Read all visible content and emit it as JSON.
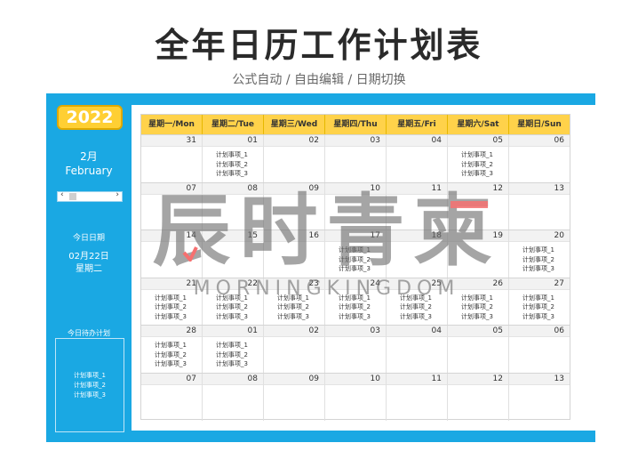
{
  "title": "全年日历工作计划表",
  "subtitle": "公式自动 / 自由编辑 / 日期切换",
  "sidebar": {
    "year": "2022",
    "month_cn": "2月",
    "month_en": "February",
    "scroll_left": "‹",
    "scroll_right": "›",
    "today_label": "今日日期",
    "today_date": "02月22日",
    "today_weekday": "星期二",
    "todo_title": "今日待办计划",
    "todo_items": [
      "计划事项_1",
      "计划事项_2",
      "计划事项_3"
    ]
  },
  "calendar": {
    "weekdays": [
      "星期一/Mon",
      "星期二/Tue",
      "星期三/Wed",
      "星期四/Thu",
      "星期五/Fri",
      "星期六/Sat",
      "星期日/Sun"
    ],
    "weeks": [
      {
        "days": [
          {
            "date": "31",
            "plans": []
          },
          {
            "date": "01",
            "plans": [
              "计划事项_1",
              "计划事项_2",
              "计划事项_3"
            ]
          },
          {
            "date": "02",
            "plans": []
          },
          {
            "date": "03",
            "plans": []
          },
          {
            "date": "04",
            "plans": []
          },
          {
            "date": "05",
            "plans": [
              "计划事项_1",
              "计划事项_2",
              "计划事项_3"
            ]
          },
          {
            "date": "06",
            "plans": []
          }
        ]
      },
      {
        "days": [
          {
            "date": "07",
            "plans": []
          },
          {
            "date": "08",
            "plans": []
          },
          {
            "date": "09",
            "plans": []
          },
          {
            "date": "10",
            "plans": []
          },
          {
            "date": "11",
            "plans": []
          },
          {
            "date": "12",
            "plans": []
          },
          {
            "date": "13",
            "plans": []
          }
        ]
      },
      {
        "days": [
          {
            "date": "14",
            "plans": []
          },
          {
            "date": "15",
            "plans": []
          },
          {
            "date": "16",
            "plans": []
          },
          {
            "date": "17",
            "plans": [
              "计划事项_1",
              "计划事项_2",
              "计划事项_3"
            ]
          },
          {
            "date": "18",
            "plans": []
          },
          {
            "date": "19",
            "plans": []
          },
          {
            "date": "20",
            "plans": [
              "计划事项_1",
              "计划事项_2",
              "计划事项_3"
            ]
          }
        ]
      },
      {
        "days": [
          {
            "date": "21",
            "plans": [
              "计划事项_1",
              "计划事项_2",
              "计划事项_3"
            ]
          },
          {
            "date": "22",
            "plans": [
              "计划事项_1",
              "计划事项_2",
              "计划事项_3"
            ]
          },
          {
            "date": "23",
            "plans": [
              "计划事项_1",
              "计划事项_2",
              "计划事项_3"
            ]
          },
          {
            "date": "24",
            "plans": [
              "计划事项_1",
              "计划事项_2",
              "计划事项_3"
            ]
          },
          {
            "date": "25",
            "plans": [
              "计划事项_1",
              "计划事项_2",
              "计划事项_3"
            ]
          },
          {
            "date": "26",
            "plans": [
              "计划事项_1",
              "计划事项_2",
              "计划事项_3"
            ]
          },
          {
            "date": "27",
            "plans": [
              "计划事项_1",
              "计划事项_2",
              "计划事项_3"
            ]
          }
        ]
      },
      {
        "days": [
          {
            "date": "28",
            "plans": [
              "计划事项_1",
              "计划事项_2",
              "计划事项_3"
            ]
          },
          {
            "date": "01",
            "plans": [
              "计划事项_1",
              "计划事项_2",
              "计划事项_3"
            ]
          },
          {
            "date": "02",
            "plans": []
          },
          {
            "date": "03",
            "plans": []
          },
          {
            "date": "04",
            "plans": []
          },
          {
            "date": "05",
            "plans": []
          },
          {
            "date": "06",
            "plans": []
          }
        ]
      },
      {
        "days": [
          {
            "date": "07",
            "plans": []
          },
          {
            "date": "08",
            "plans": []
          },
          {
            "date": "09",
            "plans": []
          },
          {
            "date": "10",
            "plans": []
          },
          {
            "date": "11",
            "plans": []
          },
          {
            "date": "12",
            "plans": []
          },
          {
            "date": "13",
            "plans": []
          }
        ]
      }
    ]
  },
  "watermark": {
    "text": "辰时青柬",
    "sub": "MORNINGKINGDOM"
  },
  "colors": {
    "frame": "#1aa8e3",
    "header": "#ffd24a",
    "year_badge": "#ffcf33",
    "watermark_accent": "#f67070"
  }
}
